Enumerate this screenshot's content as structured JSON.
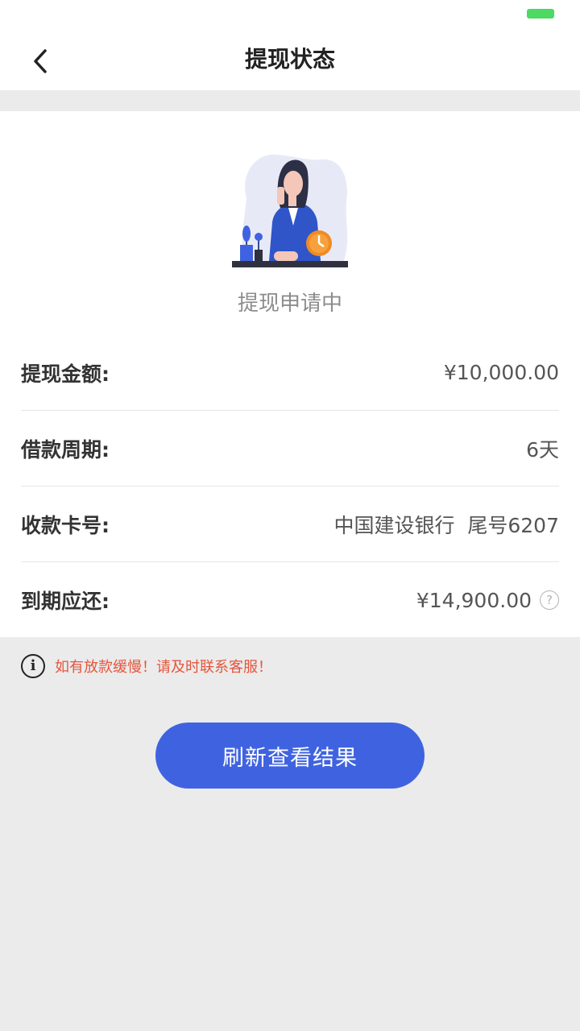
{
  "nav": {
    "title": "提现状态",
    "back_icon": "chevron-left-icon"
  },
  "status": {
    "text": "提现申请中",
    "illustration": "woman-phone-illustration"
  },
  "details": [
    {
      "label": "提现金额:",
      "value": "¥10,000.00"
    },
    {
      "label": "借款周期:",
      "value": "6天"
    },
    {
      "label": "收款卡号:",
      "value": "中国建设银行  尾号6207"
    },
    {
      "label": "到期应还:",
      "value": "¥14,900.00"
    }
  ],
  "help_icon_glyph": "?",
  "notice": {
    "icon_glyph": "i",
    "text": "如有放款缓慢！请及时联系客服！"
  },
  "actions": {
    "refresh_label": "刷新查看结果"
  },
  "colors": {
    "accent": "#3f63e0",
    "notice": "#e5553c",
    "battery": "#4cd964"
  }
}
